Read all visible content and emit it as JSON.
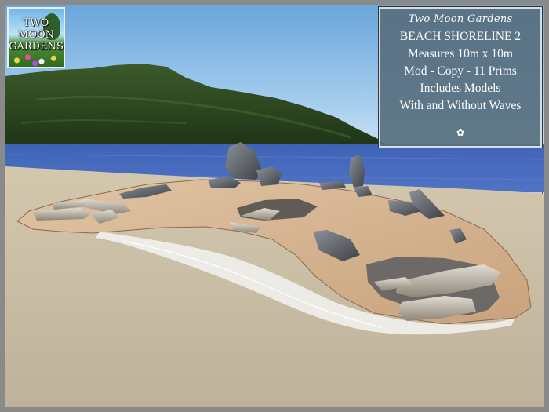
{
  "logo": {
    "line1": "TWO",
    "line2": "MOON",
    "line3": "GARDENS"
  },
  "info_panel": {
    "brand": "Two Moon Gardens",
    "lines": [
      "BEACH SHORELINE 2",
      "Measures 10m x 10m",
      "Mod - Copy - 11 Prims",
      "Includes Models",
      "With and Without Waves"
    ],
    "divider_icon": "flower-icon"
  },
  "colors": {
    "frame": "#8a8a8a",
    "panel": "#587080",
    "sky": "#7fb6e6",
    "sea": "#3f63b8",
    "sand": "#cfc3aa",
    "hill": "#2e4a22"
  }
}
